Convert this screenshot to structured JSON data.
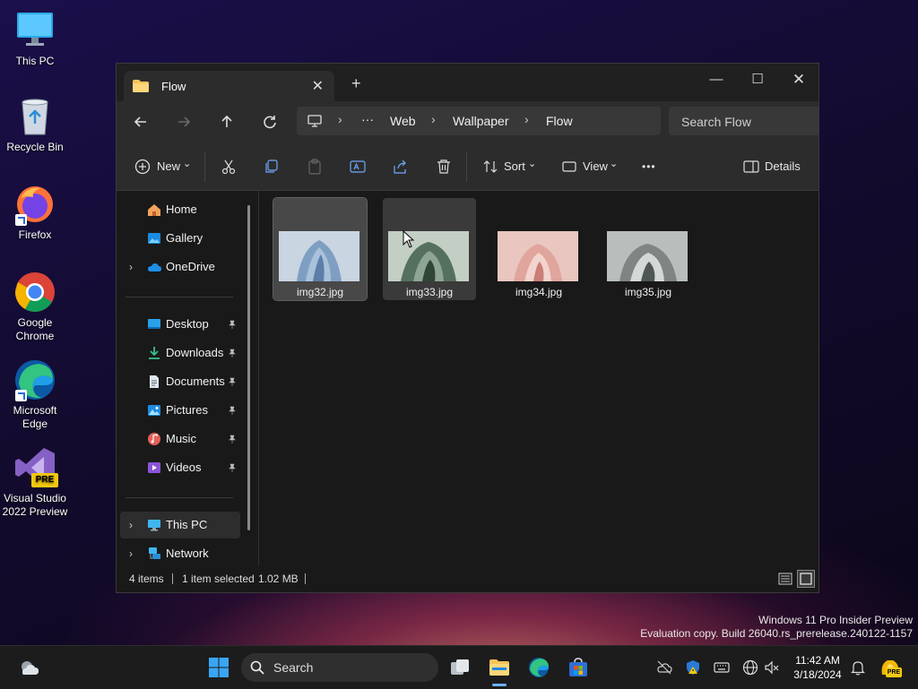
{
  "desktop": {
    "icons": [
      {
        "label": "This PC"
      },
      {
        "label": "Recycle Bin"
      },
      {
        "label": "Firefox"
      },
      {
        "label": "Google Chrome"
      },
      {
        "label": "Microsoft Edge"
      },
      {
        "label": "Visual Studio 2022 Preview"
      }
    ],
    "vs_badge": "PRE"
  },
  "window": {
    "tab_title": "Flow",
    "tab_close": "✕",
    "new_tab": "+",
    "controls": {
      "minimize": "—",
      "maximize": "☐",
      "close": "✕"
    },
    "breadcrumb": {
      "ellipsis": "···",
      "items": [
        "Web",
        "Wallpaper",
        "Flow"
      ],
      "separator": "›"
    },
    "search_placeholder": "Search Flow",
    "toolbar": {
      "new_label": "New",
      "sort_label": "Sort",
      "view_label": "View",
      "more_label": "•••",
      "details_label": "Details",
      "dropdown_glyph": "⌄"
    },
    "sidebar": {
      "top": [
        "Home",
        "Gallery",
        "OneDrive"
      ],
      "quick": [
        "Desktop",
        "Downloads",
        "Documents",
        "Pictures",
        "Music",
        "Videos"
      ],
      "bottom": [
        "This PC",
        "Network"
      ],
      "pin_glyph": "📌",
      "expand_glyph": "›"
    },
    "files": [
      {
        "name": "img32.jpg",
        "state": "selected"
      },
      {
        "name": "img33.jpg",
        "state": "hover"
      },
      {
        "name": "img34.jpg",
        "state": "normal"
      },
      {
        "name": "img35.jpg",
        "state": "normal"
      }
    ],
    "status": {
      "count": "4 items",
      "selection": "1 item selected",
      "size": "1.02 MB"
    }
  },
  "watermark": {
    "line1": "Windows 11 Pro Insider Preview",
    "line2": "Evaluation copy. Build 26040.rs_prerelease.240122-1157"
  },
  "taskbar": {
    "search_label": "Search",
    "time": "11:42 AM",
    "date": "3/18/2024",
    "copilot_badge": "PRE"
  },
  "colors": {
    "accent": "#0078d4",
    "folder": "#f4c35a"
  }
}
